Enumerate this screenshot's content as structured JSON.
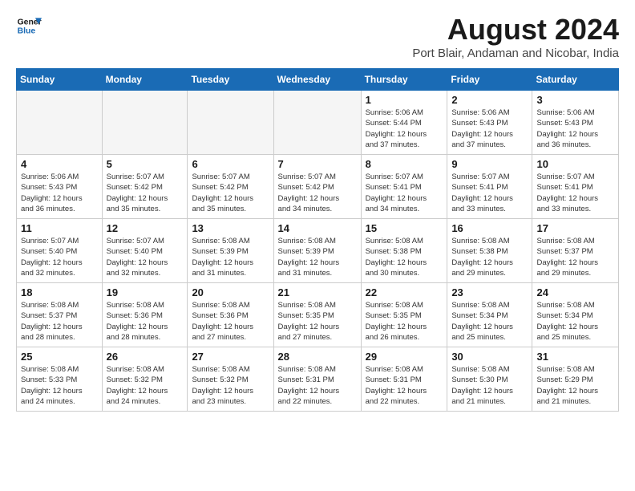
{
  "header": {
    "logo_line1": "General",
    "logo_line2": "Blue",
    "title": "August 2024",
    "subtitle": "Port Blair, Andaman and Nicobar, India"
  },
  "weekdays": [
    "Sunday",
    "Monday",
    "Tuesday",
    "Wednesday",
    "Thursday",
    "Friday",
    "Saturday"
  ],
  "weeks": [
    [
      {
        "day": "",
        "info": ""
      },
      {
        "day": "",
        "info": ""
      },
      {
        "day": "",
        "info": ""
      },
      {
        "day": "",
        "info": ""
      },
      {
        "day": "1",
        "info": "Sunrise: 5:06 AM\nSunset: 5:44 PM\nDaylight: 12 hours\nand 37 minutes."
      },
      {
        "day": "2",
        "info": "Sunrise: 5:06 AM\nSunset: 5:43 PM\nDaylight: 12 hours\nand 37 minutes."
      },
      {
        "day": "3",
        "info": "Sunrise: 5:06 AM\nSunset: 5:43 PM\nDaylight: 12 hours\nand 36 minutes."
      }
    ],
    [
      {
        "day": "4",
        "info": "Sunrise: 5:06 AM\nSunset: 5:43 PM\nDaylight: 12 hours\nand 36 minutes."
      },
      {
        "day": "5",
        "info": "Sunrise: 5:07 AM\nSunset: 5:42 PM\nDaylight: 12 hours\nand 35 minutes."
      },
      {
        "day": "6",
        "info": "Sunrise: 5:07 AM\nSunset: 5:42 PM\nDaylight: 12 hours\nand 35 minutes."
      },
      {
        "day": "7",
        "info": "Sunrise: 5:07 AM\nSunset: 5:42 PM\nDaylight: 12 hours\nand 34 minutes."
      },
      {
        "day": "8",
        "info": "Sunrise: 5:07 AM\nSunset: 5:41 PM\nDaylight: 12 hours\nand 34 minutes."
      },
      {
        "day": "9",
        "info": "Sunrise: 5:07 AM\nSunset: 5:41 PM\nDaylight: 12 hours\nand 33 minutes."
      },
      {
        "day": "10",
        "info": "Sunrise: 5:07 AM\nSunset: 5:41 PM\nDaylight: 12 hours\nand 33 minutes."
      }
    ],
    [
      {
        "day": "11",
        "info": "Sunrise: 5:07 AM\nSunset: 5:40 PM\nDaylight: 12 hours\nand 32 minutes."
      },
      {
        "day": "12",
        "info": "Sunrise: 5:07 AM\nSunset: 5:40 PM\nDaylight: 12 hours\nand 32 minutes."
      },
      {
        "day": "13",
        "info": "Sunrise: 5:08 AM\nSunset: 5:39 PM\nDaylight: 12 hours\nand 31 minutes."
      },
      {
        "day": "14",
        "info": "Sunrise: 5:08 AM\nSunset: 5:39 PM\nDaylight: 12 hours\nand 31 minutes."
      },
      {
        "day": "15",
        "info": "Sunrise: 5:08 AM\nSunset: 5:38 PM\nDaylight: 12 hours\nand 30 minutes."
      },
      {
        "day": "16",
        "info": "Sunrise: 5:08 AM\nSunset: 5:38 PM\nDaylight: 12 hours\nand 29 minutes."
      },
      {
        "day": "17",
        "info": "Sunrise: 5:08 AM\nSunset: 5:37 PM\nDaylight: 12 hours\nand 29 minutes."
      }
    ],
    [
      {
        "day": "18",
        "info": "Sunrise: 5:08 AM\nSunset: 5:37 PM\nDaylight: 12 hours\nand 28 minutes."
      },
      {
        "day": "19",
        "info": "Sunrise: 5:08 AM\nSunset: 5:36 PM\nDaylight: 12 hours\nand 28 minutes."
      },
      {
        "day": "20",
        "info": "Sunrise: 5:08 AM\nSunset: 5:36 PM\nDaylight: 12 hours\nand 27 minutes."
      },
      {
        "day": "21",
        "info": "Sunrise: 5:08 AM\nSunset: 5:35 PM\nDaylight: 12 hours\nand 27 minutes."
      },
      {
        "day": "22",
        "info": "Sunrise: 5:08 AM\nSunset: 5:35 PM\nDaylight: 12 hours\nand 26 minutes."
      },
      {
        "day": "23",
        "info": "Sunrise: 5:08 AM\nSunset: 5:34 PM\nDaylight: 12 hours\nand 25 minutes."
      },
      {
        "day": "24",
        "info": "Sunrise: 5:08 AM\nSunset: 5:34 PM\nDaylight: 12 hours\nand 25 minutes."
      }
    ],
    [
      {
        "day": "25",
        "info": "Sunrise: 5:08 AM\nSunset: 5:33 PM\nDaylight: 12 hours\nand 24 minutes."
      },
      {
        "day": "26",
        "info": "Sunrise: 5:08 AM\nSunset: 5:32 PM\nDaylight: 12 hours\nand 24 minutes."
      },
      {
        "day": "27",
        "info": "Sunrise: 5:08 AM\nSunset: 5:32 PM\nDaylight: 12 hours\nand 23 minutes."
      },
      {
        "day": "28",
        "info": "Sunrise: 5:08 AM\nSunset: 5:31 PM\nDaylight: 12 hours\nand 22 minutes."
      },
      {
        "day": "29",
        "info": "Sunrise: 5:08 AM\nSunset: 5:31 PM\nDaylight: 12 hours\nand 22 minutes."
      },
      {
        "day": "30",
        "info": "Sunrise: 5:08 AM\nSunset: 5:30 PM\nDaylight: 12 hours\nand 21 minutes."
      },
      {
        "day": "31",
        "info": "Sunrise: 5:08 AM\nSunset: 5:29 PM\nDaylight: 12 hours\nand 21 minutes."
      }
    ]
  ]
}
